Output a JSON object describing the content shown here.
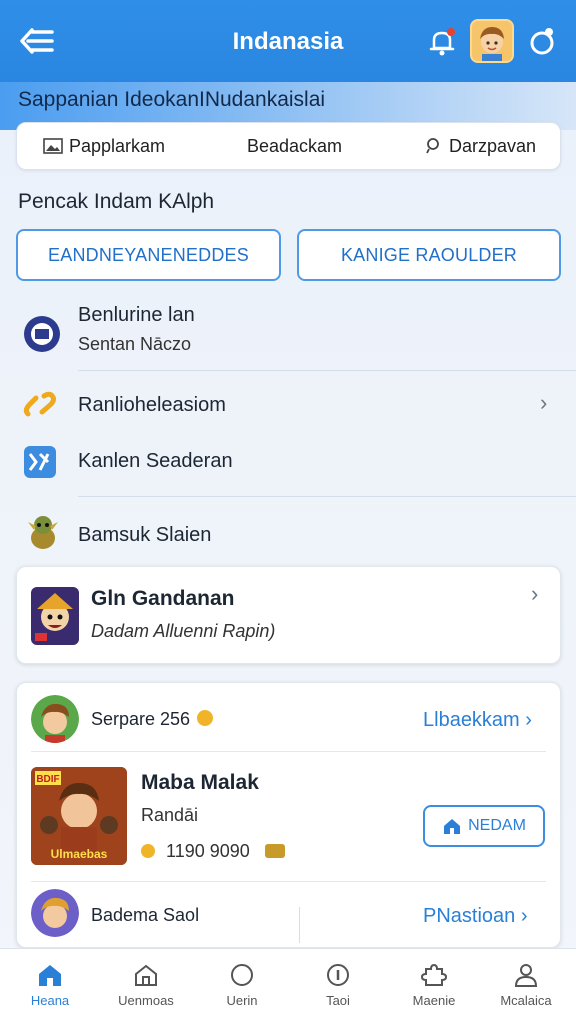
{
  "header": {
    "title": "Indanasia",
    "subheader": "Sappanian IdeokanINudankaislai"
  },
  "segments": [
    "Papplarkam",
    "Beadackam",
    "Darzpavan"
  ],
  "section": {
    "title": "Pencak Indam KAlph",
    "button_left": "EANDNEYANENEDDES",
    "button_right": "KANIGE RAOULDER"
  },
  "list": [
    {
      "title": "Benlurine lan",
      "subtitle": "Sentan Nāczo"
    },
    {
      "title": "Ranlioheleasiom"
    },
    {
      "title": "Kanlen Seaderan"
    },
    {
      "title": "Bamsuk Slaien"
    }
  ],
  "card1": {
    "title": "Gln Gandanan",
    "subtitle": "Dadam Alluenni Rapin)"
  },
  "card2": {
    "row1": {
      "label": "Serpare 256",
      "link": "Llbaekkam"
    },
    "game": {
      "title": "Maba Malak",
      "subtitle": "Randāi",
      "stat": "1190 9090",
      "button": "NEDAM",
      "thumb_text": "Ulmaebas",
      "badge": "BDIF"
    },
    "row3": {
      "label": "Badema Saol",
      "link": "PNastioan"
    }
  },
  "bottom_nav": [
    "Heana",
    "Uenmoas",
    "Uerin",
    "Taoi",
    "Maenie",
    "Mcalaica"
  ],
  "colors": {
    "primary": "#2a86e0",
    "accent": "#2a7fd6"
  }
}
